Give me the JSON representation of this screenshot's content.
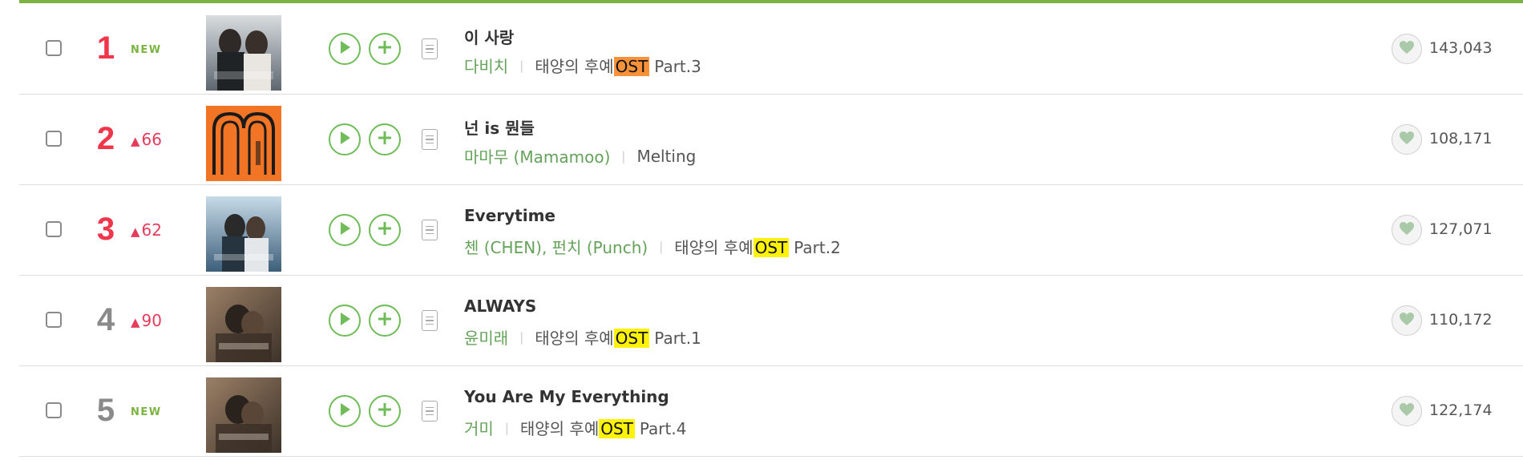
{
  "chart": {
    "rows": [
      {
        "rank": "1",
        "change": {
          "type": "new",
          "label": "NEW"
        },
        "cover": "cover-couple-drama",
        "title": "이 사랑",
        "artist": "다비치",
        "album_prefix": "태양의 후예",
        "album_tag": "OST",
        "album_suffix": "Part.3",
        "tag_color": "orange",
        "likes": "143,043"
      },
      {
        "rank": "2",
        "change": {
          "type": "up",
          "value": "66"
        },
        "cover": "cover-orange-m-logo",
        "title": "넌 is 뭔들",
        "artist": "마마무 (Mamamoo)",
        "album_prefix": "Melting",
        "album_tag": "",
        "album_suffix": "",
        "tag_color": "",
        "likes": "108,171"
      },
      {
        "rank": "3",
        "change": {
          "type": "up",
          "value": "62"
        },
        "cover": "cover-blue-drama",
        "title": "Everytime",
        "artist": "첸 (CHEN), 펀치 (Punch)",
        "album_prefix": "태양의 후예",
        "album_tag": "OST",
        "album_suffix": "Part.2",
        "tag_color": "yellow",
        "likes": "127,071"
      },
      {
        "rank": "4",
        "change": {
          "type": "up",
          "value": "90"
        },
        "cover": "cover-sepia-drama",
        "title": "ALWAYS",
        "artist": "윤미래",
        "album_prefix": "태양의 후예",
        "album_tag": "OST",
        "album_suffix": "Part.1",
        "tag_color": "yellow",
        "likes": "110,172"
      },
      {
        "rank": "5",
        "change": {
          "type": "new",
          "label": "NEW"
        },
        "cover": "cover-sepia-drama",
        "title": "You Are My Everything",
        "artist": "거미",
        "album_prefix": "태양의 후예",
        "album_tag": "OST",
        "album_suffix": "Part.4",
        "tag_color": "yellow",
        "likes": "122,174"
      }
    ]
  },
  "icons": {
    "play": "play-icon",
    "add": "plus-icon",
    "lyrics": "lyrics-icon",
    "like": "heart-icon"
  },
  "colors": {
    "accent_green": "#7cb342",
    "top_rank_red": "#f0364a",
    "rank_grey": "#8a8a8a",
    "rank_up_pink": "#e53c5c",
    "artist_green": "#64a25a",
    "ost_orange": "#f7923b",
    "ost_yellow": "#fef20a"
  }
}
